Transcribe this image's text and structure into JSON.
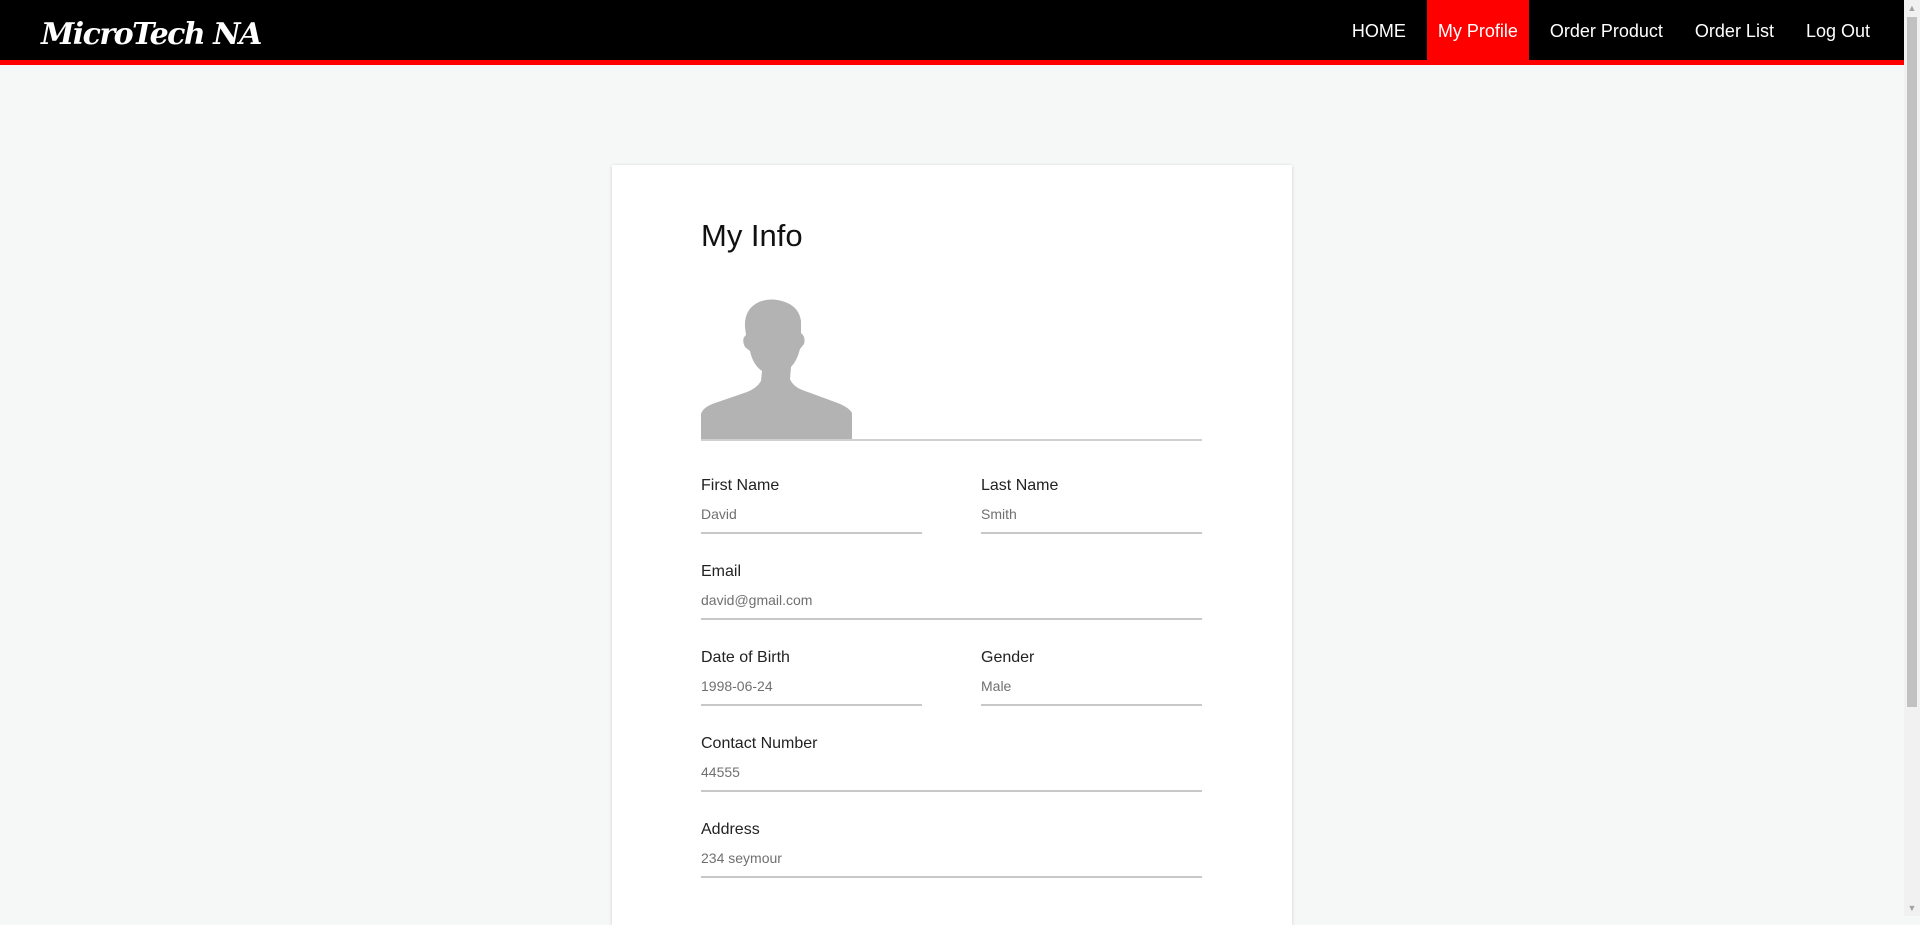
{
  "brand": {
    "name": "MicroTech NA"
  },
  "nav": {
    "items": [
      {
        "label": "HOME",
        "active": false
      },
      {
        "label": "My Profile",
        "active": true
      },
      {
        "label": "Order Product",
        "active": false
      },
      {
        "label": "Order List",
        "active": false
      },
      {
        "label": "Log Out",
        "active": false
      }
    ]
  },
  "profile": {
    "title": "My Info",
    "avatar_icon": "person-silhouette-icon",
    "fields": {
      "first_name": {
        "label": "First Name",
        "value": "David"
      },
      "last_name": {
        "label": "Last Name",
        "value": "Smith"
      },
      "email": {
        "label": "Email",
        "value": "david@gmail.com"
      },
      "dob": {
        "label": "Date of Birth",
        "value": "1998-06-24"
      },
      "gender": {
        "label": "Gender",
        "value": "Male"
      },
      "contact": {
        "label": "Contact Number",
        "value": "44555"
      },
      "address": {
        "label": "Address",
        "value": "234 seymour"
      }
    }
  },
  "colors": {
    "navbar_bg": "#000000",
    "accent": "#ff0000",
    "page_bg": "#f6f8f8",
    "avatar_gray": "#b3b3b3"
  }
}
